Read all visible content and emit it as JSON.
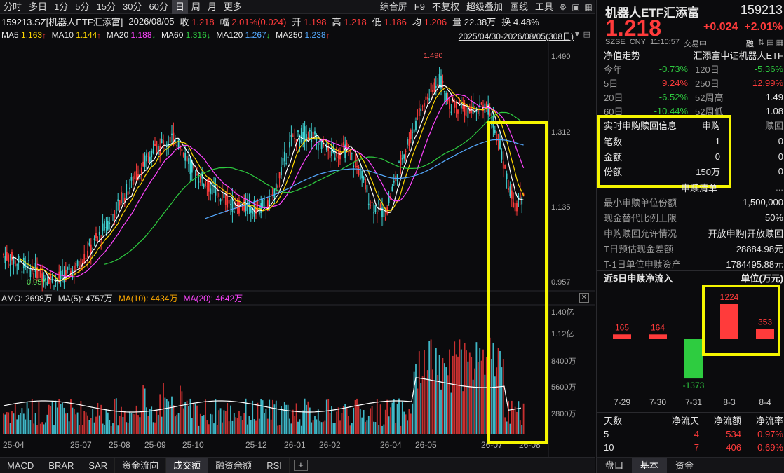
{
  "toolbar": {
    "periods": [
      "分时",
      "多日",
      "1分",
      "5分",
      "15分",
      "30分",
      "60分",
      "日",
      "周",
      "月",
      "更多"
    ],
    "active_period": "日",
    "right_items": [
      "综合屏",
      "F9",
      "不复权",
      "超级叠加",
      "画线",
      "工具"
    ],
    "icons": [
      "settings-icon",
      "layout-icon",
      "grid-icon"
    ]
  },
  "info": {
    "security": "159213.SZ[机器人ETF汇添富]",
    "date": "2026/08/05",
    "close_label": "收",
    "close": "1.218",
    "amp_label": "幅",
    "amp": "2.01%(0.024)",
    "open_label": "开",
    "open": "1.198",
    "high_label": "高",
    "high": "1.218",
    "low_label": "低",
    "low": "1.186",
    "avg_label": "均",
    "avg": "1.206",
    "amount_label": "量",
    "amount": "22.38万",
    "turnover_label": "换",
    "turnover": "4.48%"
  },
  "ma": {
    "items": [
      {
        "label": "MA5",
        "value": "1.163",
        "dir": "↑",
        "color": "#ffd700"
      },
      {
        "label": "MA10",
        "value": "1.144",
        "dir": "↑",
        "color": "#ffd700"
      },
      {
        "label": "MA20",
        "value": "1.188",
        "dir": "↓",
        "color": "#ff44ff"
      },
      {
        "label": "MA60",
        "value": "1.316",
        "dir": "↓",
        "color": "#2ecc40"
      },
      {
        "label": "MA120",
        "value": "1.267",
        "dir": "↓",
        "color": "#55aaff"
      },
      {
        "label": "MA250",
        "value": "1.238",
        "dir": "↑",
        "color": "#55aaff"
      }
    ],
    "date_range": "2025/04/30-2026/08/05(308日)"
  },
  "price_axis": [
    "1.490",
    "1.312",
    "1.135",
    "0.957"
  ],
  "price_annotations": {
    "high": "1.490",
    "low": "0.957"
  },
  "amo": {
    "label": "AMO: 2698万",
    "ma5": "MA(5): 4757万",
    "ma10": "MA(10): 4434万",
    "ma20": "MA(20): 4642万",
    "axis": [
      "1.40亿",
      "1.12亿",
      "8400万",
      "5600万",
      "2800万"
    ]
  },
  "x_ticks": [
    "25-04",
    "25-07",
    "25-08",
    "25-09",
    "25-10",
    "25-12",
    "26-01",
    "26-02",
    "26-04",
    "26-05",
    "26-07",
    "26-08"
  ],
  "bottom_tabs": [
    "MACD",
    "BRAR",
    "SAR",
    "资金流向",
    "成交额",
    "融资余额",
    "RSI"
  ],
  "bottom_active": "成交额",
  "panel": {
    "title": "机器人ETF汇添富",
    "code": "159213",
    "price": "1.218",
    "change": "+0.024",
    "change_pct": "+2.01%",
    "meta": [
      "SZSE",
      "CNY",
      "11:10:57",
      "交易中"
    ],
    "margin_tag": "融",
    "nav_title": "净值走势",
    "nav_index": "汇添富中证机器人ETF",
    "perf": [
      {
        "l1": "今年",
        "v1": "-0.73%",
        "c1": "green",
        "l2": "120日",
        "v2": "-5.36%",
        "c2": "green"
      },
      {
        "l1": "5日",
        "v1": "9.24%",
        "c1": "red",
        "l2": "250日",
        "v2": "12.99%",
        "c2": "red"
      },
      {
        "l1": "20日",
        "v1": "-6.52%",
        "c1": "green",
        "l2": "52周高",
        "v2": "1.49",
        "c2": "white"
      },
      {
        "l1": "60日",
        "v1": "-10.44%",
        "c1": "green",
        "l2": "52周低",
        "v2": "1.08",
        "c2": "white"
      }
    ],
    "creation": {
      "header": [
        "实时申购赎回信息",
        "申购",
        "赎回"
      ],
      "rows": [
        {
          "label": "笔数",
          "sub": "1",
          "red": "0"
        },
        {
          "label": "金额",
          "sub": "0",
          "red": "0"
        },
        {
          "label": "份额",
          "sub": "150万",
          "red": "0"
        }
      ]
    },
    "list_title": "申赎清单",
    "list": [
      {
        "label": "最小申赎单位份额",
        "value": "1,500,000"
      },
      {
        "label": "现金替代比例上限",
        "value": "50%"
      },
      {
        "label": "申购赎回允许情况",
        "value": "开放申购|开放赎回"
      },
      {
        "label": "T日预估现金差额",
        "value": "28884.98元"
      },
      {
        "label": "T-1日单位申赎资产",
        "value": "1784495.88元"
      }
    ],
    "flow_title": "近5日申赎净流入",
    "flow_unit": "单位(万元)",
    "flow": {
      "categories": [
        "7-29",
        "7-30",
        "7-31",
        "8-3",
        "8-4"
      ],
      "values": [
        165,
        164,
        -1373,
        1224,
        353
      ]
    },
    "summary_header": [
      "天数",
      "净流天",
      "净流额",
      "净流率"
    ],
    "summary": [
      {
        "days": "5",
        "flow_days": "4",
        "amount": "534",
        "rate": "0.97%"
      },
      {
        "days": "10",
        "flow_days": "7",
        "amount": "406",
        "rate": "0.69%"
      }
    ],
    "tabs": [
      "盘口",
      "基本",
      "资金"
    ],
    "active_tab": "基本"
  },
  "colors": {
    "up": "#ff3b3b",
    "down": "#2ecc40",
    "highlight": "#f5f500",
    "bg": "#0b0b0d"
  }
}
